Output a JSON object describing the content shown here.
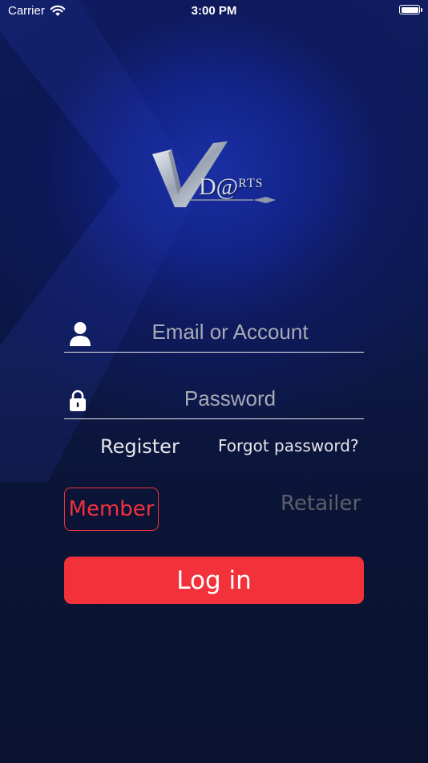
{
  "status_bar": {
    "carrier": "Carrier",
    "time": "3:00 PM"
  },
  "logo": {
    "initial": "V",
    "text_main": "D@",
    "text_small": "RTS"
  },
  "form": {
    "email_placeholder": "Email or Account",
    "email_value": "",
    "password_placeholder": "Password",
    "password_value": ""
  },
  "links": {
    "register": "Register",
    "forgot_password": "Forgot password?"
  },
  "role_toggle": {
    "member": "Member",
    "retailer": "Retailer",
    "selected": "member"
  },
  "actions": {
    "login": "Log in"
  },
  "colors": {
    "accent": "#f2313b",
    "background": "#0b1434",
    "inactive_text": "#5d5f68"
  },
  "icons": {
    "wifi": "wifi-icon",
    "battery": "battery-icon",
    "user": "user-icon",
    "lock": "lock-icon"
  }
}
